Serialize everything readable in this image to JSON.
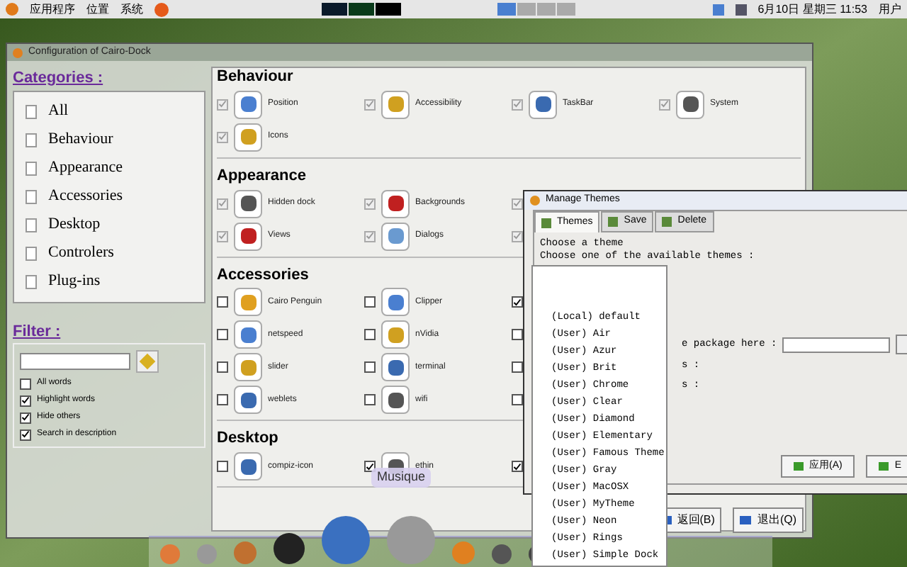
{
  "top_panel": {
    "menus": [
      "应用程序",
      "位置",
      "系统"
    ],
    "clock": "6月10日 星期三 11:53",
    "user": "用户"
  },
  "main_window": {
    "title": "Configuration of Cairo-Dock",
    "categories": {
      "title": "Categories :",
      "items": [
        {
          "label": "All",
          "selected": false
        },
        {
          "label": "Behaviour",
          "selected": false
        },
        {
          "label": "Appearance",
          "selected": false
        },
        {
          "label": "Accessories",
          "selected": false
        },
        {
          "label": "Desktop",
          "selected": false
        },
        {
          "label": "Controlers",
          "selected": false
        },
        {
          "label": "Plug-ins",
          "selected": false
        }
      ]
    },
    "filter": {
      "title": "Filter :",
      "options": [
        {
          "label": "All words",
          "checked": false
        },
        {
          "label": "Highlight words",
          "checked": true
        },
        {
          "label": "Hide others",
          "checked": true
        },
        {
          "label": "Search in description",
          "checked": true
        }
      ]
    },
    "sections": [
      {
        "title": "Behaviour",
        "rows": [
          [
            {
              "label": "Position",
              "checked": true,
              "disabled": true
            },
            {
              "label": "Accessibility",
              "checked": true,
              "disabled": true
            },
            {
              "label": "TaskBar",
              "checked": true,
              "disabled": true
            },
            {
              "label": "System",
              "checked": true,
              "disabled": true
            }
          ],
          [
            {
              "label": "Icons",
              "checked": true,
              "disabled": true
            }
          ]
        ]
      },
      {
        "title": "Appearance",
        "rows": [
          [
            {
              "label": "Hidden dock",
              "checked": true,
              "disabled": true
            },
            {
              "label": "Backgrounds",
              "checked": true,
              "disabled": true
            },
            {
              "checked": true,
              "disabled": true
            }
          ],
          [
            {
              "label": "Views",
              "checked": true,
              "disabled": true
            },
            {
              "label": "Dialogs",
              "checked": true,
              "disabled": true
            },
            {
              "checked": true,
              "disabled": true
            }
          ]
        ]
      },
      {
        "title": "Accessories",
        "rows": [
          [
            {
              "label": "Cairo Penguin",
              "checked": false,
              "disabled": false
            },
            {
              "label": "Clipper",
              "checked": false,
              "disabled": false
            },
            {
              "checked": true,
              "disabled": false
            }
          ],
          [
            {
              "label": "netspeed",
              "checked": false,
              "disabled": false
            },
            {
              "label": "nVidia",
              "checked": false,
              "disabled": false
            },
            {
              "checked": false,
              "disabled": false
            }
          ],
          [
            {
              "label": "slider",
              "checked": false,
              "disabled": false
            },
            {
              "label": "terminal",
              "checked": false,
              "disabled": false
            },
            {
              "checked": false,
              "disabled": false
            }
          ],
          [
            {
              "label": "weblets",
              "checked": false,
              "disabled": false
            },
            {
              "label": "wifi",
              "checked": false,
              "disabled": false
            },
            {
              "checked": false,
              "disabled": false
            }
          ]
        ]
      },
      {
        "title": "Desktop",
        "rows": [
          [
            {
              "label": "compiz-icon",
              "checked": false,
              "disabled": false
            },
            {
              "label": "ethin",
              "checked": true,
              "disabled": false
            },
            {
              "checked": true,
              "disabled": false
            }
          ]
        ]
      }
    ],
    "tooltip": "Musique",
    "buttons": [
      "返回(B)",
      "退出(Q)"
    ]
  },
  "themes_window": {
    "title": "Manage Themes",
    "tabs": [
      {
        "label": "Themes",
        "selected": true
      },
      {
        "label": "Save",
        "selected": false
      },
      {
        "label": "Delete",
        "selected": false
      }
    ],
    "group_title": "Choose a theme",
    "prompt": "Choose one of the available themes :",
    "package_label": "e package here :",
    "lines": [
      "s :",
      "s :"
    ],
    "buttons": [
      "应用(A)",
      "E"
    ],
    "dropdown": [
      "(Local) default",
      "(User) Air",
      "(User) Azur",
      "(User) Brit",
      "(User) Chrome",
      "(User) Clear",
      "(User) Diamond",
      "(User) Elementary",
      "(User) Famous Theme",
      "(User) Gray",
      "(User) MacOSX",
      "(User) MyTheme",
      "(User) Neon",
      "(User) Rings",
      "(User) Simple Dock"
    ]
  }
}
